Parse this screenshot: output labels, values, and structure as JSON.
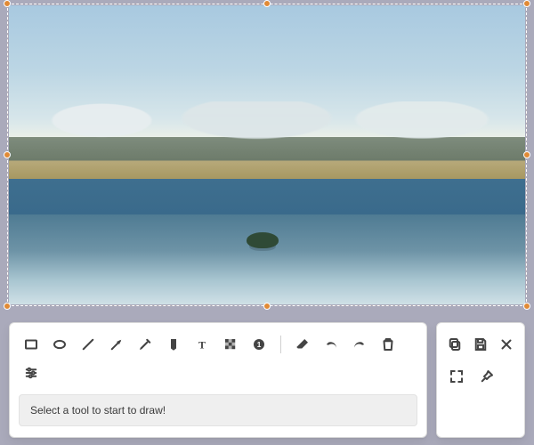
{
  "selection": {
    "handles": {
      "nw": "handle-nw",
      "n": "handle-n",
      "ne": "handle-ne",
      "w": "handle-w",
      "e": "handle-e",
      "sw": "handle-sw",
      "s": "handle-s",
      "se": "handle-se"
    }
  },
  "toolbar": {
    "tools": {
      "rectangle": "Rectangle",
      "ellipse": "Ellipse",
      "line": "Line",
      "arrow": "Arrow",
      "pen": "Pen",
      "fill": "Fill",
      "text": "Text",
      "pixelate": "Pixelate",
      "counter": "Counter"
    },
    "edit": {
      "eraser": "Eraser",
      "undo": "Undo",
      "redo": "Redo",
      "delete": "Delete",
      "properties": "Properties"
    },
    "hint": "Select a tool to start to draw!"
  },
  "sidebar": {
    "copy": "Copy",
    "save": "Save",
    "close": "Close",
    "fullscreen": "Fullscreen",
    "pin": "Pin"
  },
  "colors": {
    "selection_border": "#e08a36",
    "icon": "#444444",
    "hint_bg": "#efefef"
  }
}
